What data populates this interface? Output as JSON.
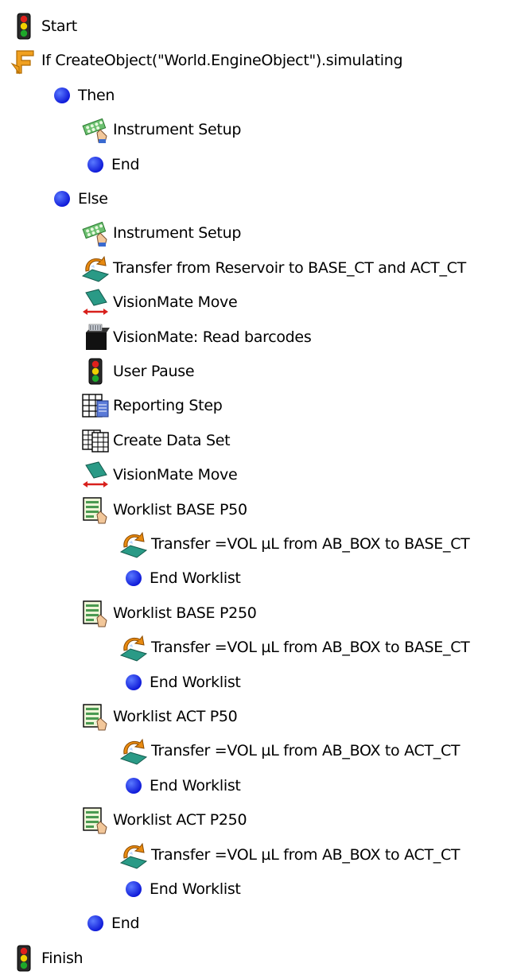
{
  "colors": {
    "end_dot": "#0a14d6",
    "traffic_red": "#e0201c",
    "traffic_yellow": "#f0d000",
    "traffic_green": "#1ea82a",
    "transfer_arrow": "#e88a10",
    "plate_teal": "#2a9a86",
    "move_arrow": "#d8201c"
  },
  "steps": [
    {
      "label": "Start",
      "depth": 0,
      "icon": "traffic-light-icon"
    },
    {
      "label": "If CreateObject(\"World.EngineObject\").simulating",
      "depth": 0,
      "icon": "if-branch-icon"
    },
    {
      "label": "Then",
      "depth": 1,
      "icon": "blue-dot-icon"
    },
    {
      "label": "Instrument Setup",
      "depth": 2,
      "icon": "instrument-setup-icon"
    },
    {
      "label": "End",
      "depth": 2,
      "icon": "blue-dot-icon"
    },
    {
      "label": "Else",
      "depth": 1,
      "icon": "blue-dot-icon"
    },
    {
      "label": "Instrument Setup",
      "depth": 2,
      "icon": "instrument-setup-icon"
    },
    {
      "label": "Transfer  from Reservoir to BASE_CT and ACT_CT",
      "depth": 2,
      "icon": "transfer-icon"
    },
    {
      "label": "VisionMate Move",
      "depth": 2,
      "icon": "visionmate-move-icon"
    },
    {
      "label": "VisionMate: Read barcodes",
      "depth": 2,
      "icon": "barcode-reader-icon"
    },
    {
      "label": "User Pause",
      "depth": 2,
      "icon": "traffic-light-icon"
    },
    {
      "label": "Reporting Step",
      "depth": 2,
      "icon": "reporting-icon"
    },
    {
      "label": "Create Data Set",
      "depth": 2,
      "icon": "data-set-icon"
    },
    {
      "label": "VisionMate Move",
      "depth": 2,
      "icon": "visionmate-move-icon"
    },
    {
      "label": "Worklist BASE P50",
      "depth": 2,
      "icon": "worklist-icon"
    },
    {
      "label": "Transfer =VOL µL from AB_BOX to BASE_CT",
      "depth": 3,
      "icon": "transfer-icon"
    },
    {
      "label": "End Worklist",
      "depth": 3,
      "icon": "blue-dot-icon"
    },
    {
      "label": "Worklist BASE P250",
      "depth": 2,
      "icon": "worklist-icon"
    },
    {
      "label": "Transfer =VOL µL from AB_BOX to BASE_CT",
      "depth": 3,
      "icon": "transfer-icon"
    },
    {
      "label": "End Worklist",
      "depth": 3,
      "icon": "blue-dot-icon"
    },
    {
      "label": "Worklist ACT P50",
      "depth": 2,
      "icon": "worklist-icon"
    },
    {
      "label": "Transfer =VOL µL from AB_BOX to ACT_CT",
      "depth": 3,
      "icon": "transfer-icon"
    },
    {
      "label": "End Worklist",
      "depth": 3,
      "icon": "blue-dot-icon"
    },
    {
      "label": "Worklist ACT P250",
      "depth": 2,
      "icon": "worklist-icon"
    },
    {
      "label": "Transfer =VOL µL from AB_BOX to ACT_CT",
      "depth": 3,
      "icon": "transfer-icon"
    },
    {
      "label": "End Worklist",
      "depth": 3,
      "icon": "blue-dot-icon"
    },
    {
      "label": "End",
      "depth": 2,
      "icon": "blue-dot-icon"
    },
    {
      "label": "Finish",
      "depth": 0,
      "icon": "traffic-light-icon"
    }
  ]
}
